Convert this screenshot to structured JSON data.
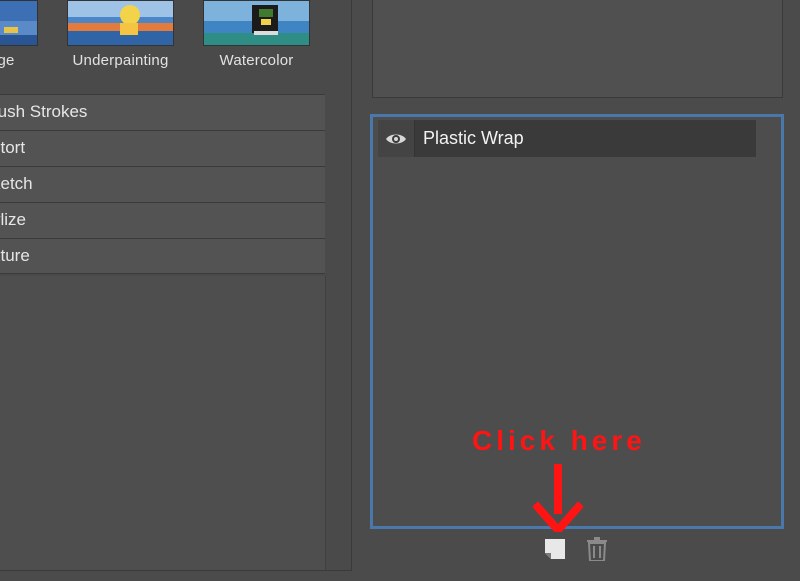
{
  "filter_gallery": {
    "thumbnails": [
      {
        "label": "ge"
      },
      {
        "label": "Underpainting"
      },
      {
        "label": "Watercolor"
      }
    ],
    "categories": [
      {
        "label": "rush Strokes"
      },
      {
        "label": "stort"
      },
      {
        "label": "ketch"
      },
      {
        "label": "ylize"
      },
      {
        "label": "xture"
      }
    ]
  },
  "effect_layers": {
    "items": [
      {
        "name": "Plastic Wrap",
        "visible": true
      }
    ],
    "new_layer_icon": "new-effect-layer-icon",
    "delete_icon": "trash-icon"
  },
  "annotation": {
    "text": "Click here",
    "color": "#ff1414"
  },
  "colors": {
    "selection_border": "#4a78aa",
    "panel_bg": "#4b4b4b"
  }
}
